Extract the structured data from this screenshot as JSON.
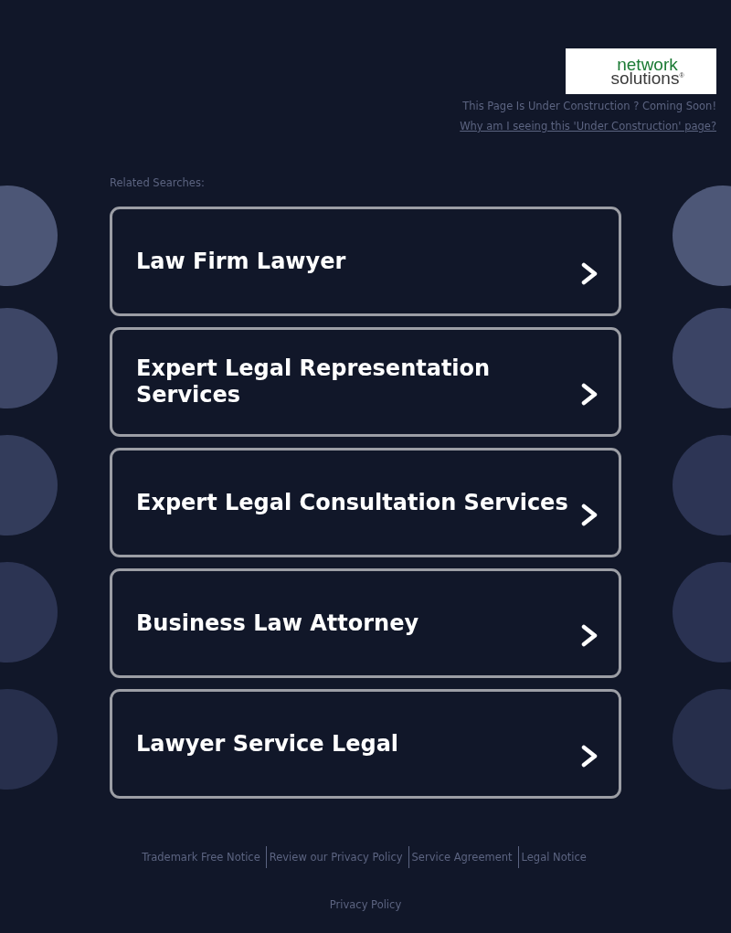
{
  "logo": {
    "line_1": "network",
    "line_2": "solutions$^{®}$"
  },
  "notice": "This Page Is Under Construction ? Coming Soon!",
  "notice_link": "Why am I seeing this 'Under Construction' page?",
  "related_searches": {
    "heading": "Related Searches:",
    "items": [
      "Law Firm Lawyer",
      "Expert Legal Representation Services",
      "Expert Legal Consultation Services",
      "Business Law Attorney",
      "Lawyer Service Legal"
    ]
  },
  "footer": {
    "links": [
      "Trademark Free Notice",
      "Review our Privacy Policy",
      "Service Agreement",
      "Legal Notice"
    ],
    "privacy_link": "Privacy Policy"
  }
}
